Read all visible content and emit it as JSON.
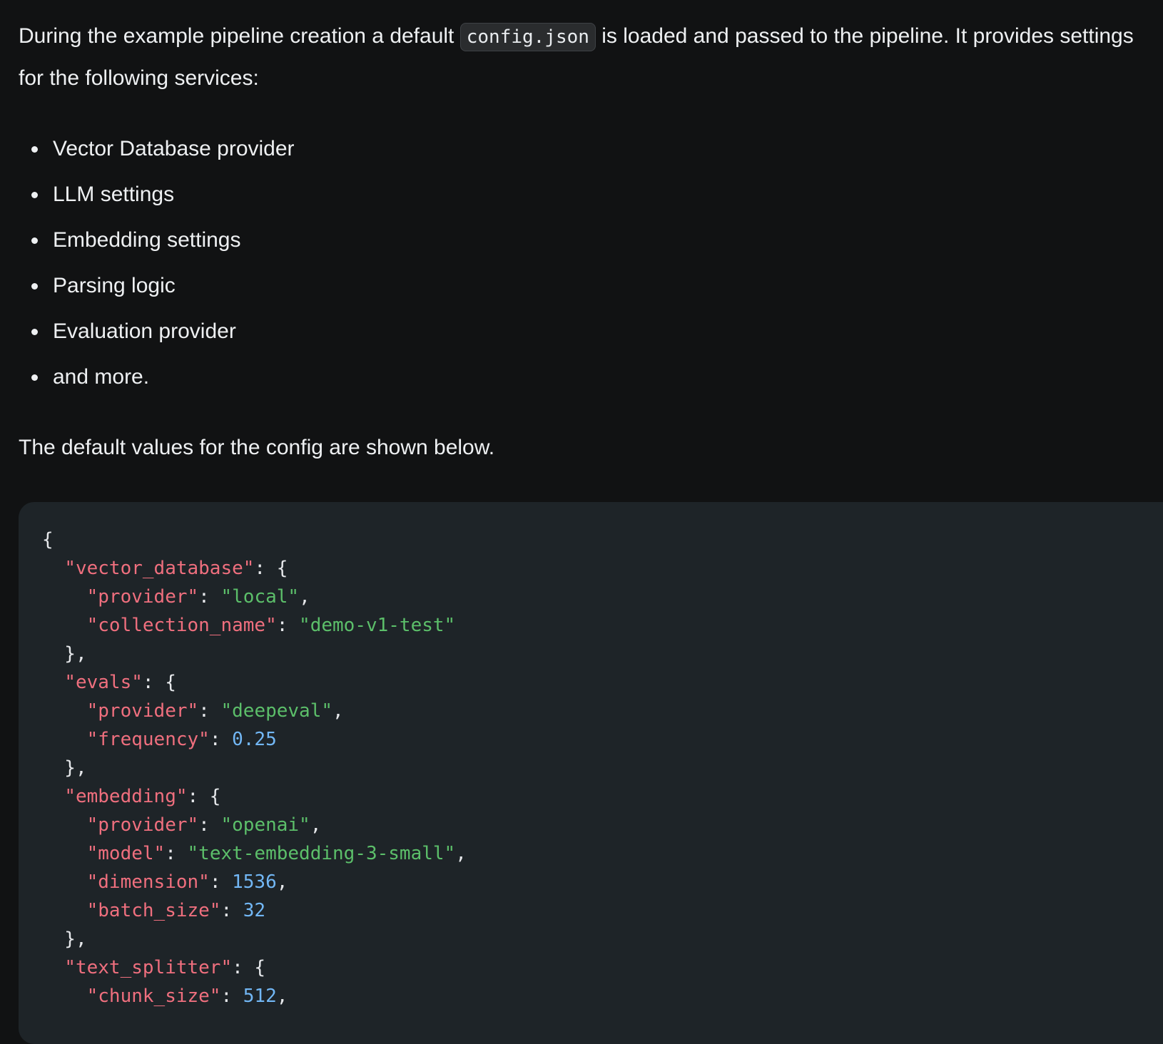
{
  "intro": {
    "before": "During the example pipeline creation a default ",
    "code": "config.json",
    "after": " is loaded and passed to the pipeline. It provides settings for the following services:"
  },
  "features": [
    "Vector Database provider",
    "LLM settings",
    "Embedding settings",
    "Parsing logic",
    "Evaluation provider",
    "and more."
  ],
  "outro": "The default values for the config are shown below.",
  "code_lines": [
    [
      {
        "t": "p",
        "v": "{"
      }
    ],
    [
      {
        "t": "p",
        "v": "  "
      },
      {
        "t": "k",
        "v": "\"vector_database\""
      },
      {
        "t": "p",
        "v": ": {"
      }
    ],
    [
      {
        "t": "p",
        "v": "    "
      },
      {
        "t": "k",
        "v": "\"provider\""
      },
      {
        "t": "p",
        "v": ": "
      },
      {
        "t": "s",
        "v": "\"local\""
      },
      {
        "t": "p",
        "v": ","
      }
    ],
    [
      {
        "t": "p",
        "v": "    "
      },
      {
        "t": "k",
        "v": "\"collection_name\""
      },
      {
        "t": "p",
        "v": ": "
      },
      {
        "t": "s",
        "v": "\"demo-v1-test\""
      }
    ],
    [
      {
        "t": "p",
        "v": "  },"
      }
    ],
    [
      {
        "t": "p",
        "v": "  "
      },
      {
        "t": "k",
        "v": "\"evals\""
      },
      {
        "t": "p",
        "v": ": {"
      }
    ],
    [
      {
        "t": "p",
        "v": "    "
      },
      {
        "t": "k",
        "v": "\"provider\""
      },
      {
        "t": "p",
        "v": ": "
      },
      {
        "t": "s",
        "v": "\"deepeval\""
      },
      {
        "t": "p",
        "v": ","
      }
    ],
    [
      {
        "t": "p",
        "v": "    "
      },
      {
        "t": "k",
        "v": "\"frequency\""
      },
      {
        "t": "p",
        "v": ": "
      },
      {
        "t": "n",
        "v": "0.25"
      }
    ],
    [
      {
        "t": "p",
        "v": "  },"
      }
    ],
    [
      {
        "t": "p",
        "v": "  "
      },
      {
        "t": "k",
        "v": "\"embedding\""
      },
      {
        "t": "p",
        "v": ": {"
      }
    ],
    [
      {
        "t": "p",
        "v": "    "
      },
      {
        "t": "k",
        "v": "\"provider\""
      },
      {
        "t": "p",
        "v": ": "
      },
      {
        "t": "s",
        "v": "\"openai\""
      },
      {
        "t": "p",
        "v": ","
      }
    ],
    [
      {
        "t": "p",
        "v": "    "
      },
      {
        "t": "k",
        "v": "\"model\""
      },
      {
        "t": "p",
        "v": ": "
      },
      {
        "t": "s",
        "v": "\"text-embedding-3-small\""
      },
      {
        "t": "p",
        "v": ","
      }
    ],
    [
      {
        "t": "p",
        "v": "    "
      },
      {
        "t": "k",
        "v": "\"dimension\""
      },
      {
        "t": "p",
        "v": ": "
      },
      {
        "t": "n",
        "v": "1536"
      },
      {
        "t": "p",
        "v": ","
      }
    ],
    [
      {
        "t": "p",
        "v": "    "
      },
      {
        "t": "k",
        "v": "\"batch_size\""
      },
      {
        "t": "p",
        "v": ": "
      },
      {
        "t": "n",
        "v": "32"
      }
    ],
    [
      {
        "t": "p",
        "v": "  },"
      }
    ],
    [
      {
        "t": "p",
        "v": "  "
      },
      {
        "t": "k",
        "v": "\"text_splitter\""
      },
      {
        "t": "p",
        "v": ": {"
      }
    ],
    [
      {
        "t": "p",
        "v": "    "
      },
      {
        "t": "k",
        "v": "\"chunk_size\""
      },
      {
        "t": "p",
        "v": ": "
      },
      {
        "t": "n",
        "v": "512"
      },
      {
        "t": "p",
        "v": ","
      }
    ]
  ],
  "colors": {
    "background": "#111213",
    "code_background": "#1e2428",
    "json_key": "#ef6f7e",
    "json_string": "#5cbf6a",
    "json_number": "#72b7f5"
  }
}
